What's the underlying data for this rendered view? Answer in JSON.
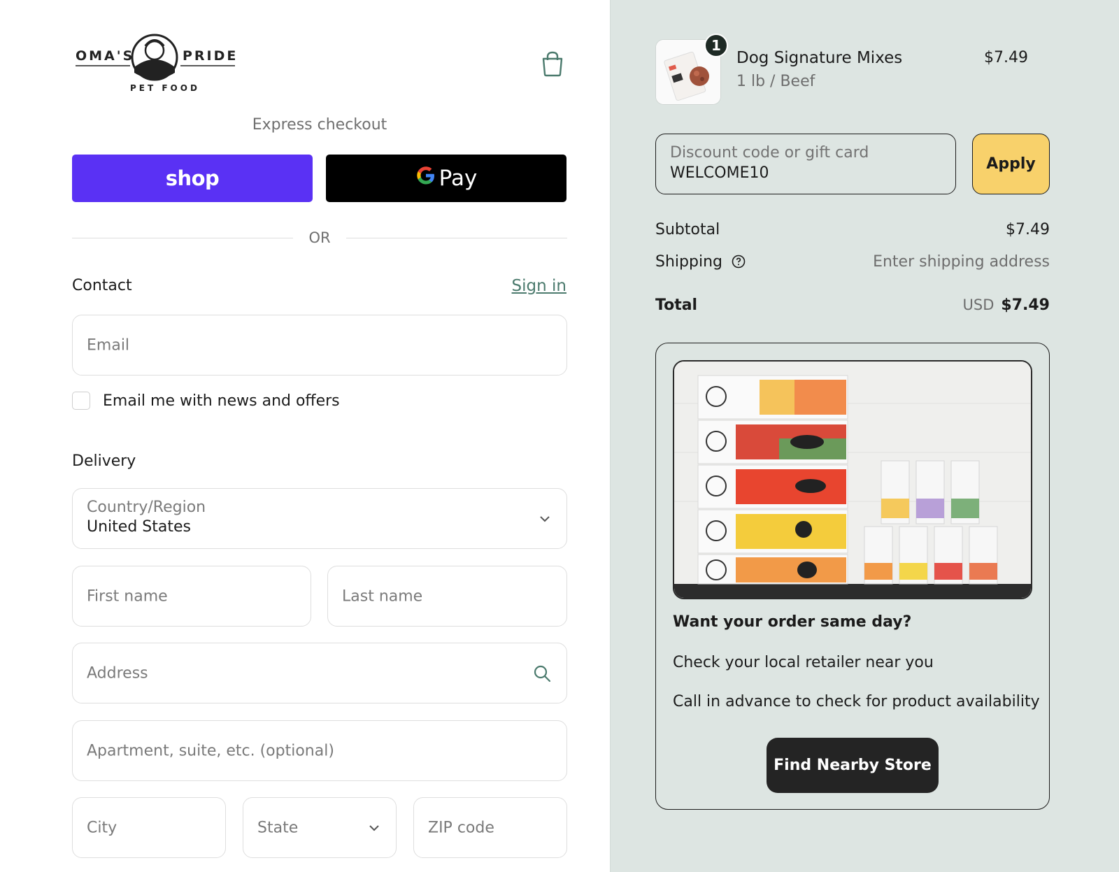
{
  "brand": {
    "logo_text_left": "OMA'S",
    "logo_text_right": "PRIDE",
    "logo_sub": "PET FOOD"
  },
  "express": {
    "label": "Express checkout",
    "shop_label": "shop",
    "gpay_g": "G",
    "gpay_label": "Pay"
  },
  "divider": {
    "or": "OR"
  },
  "contact": {
    "title": "Contact",
    "signin": "Sign in",
    "email_placeholder": "Email",
    "news_label": "Email me with news and offers",
    "news_checked": false
  },
  "delivery": {
    "title": "Delivery",
    "country_label": "Country/Region",
    "country_value": "United States",
    "first_name": "First name",
    "last_name": "Last name",
    "address": "Address",
    "apartment": "Apartment, suite, etc. (optional)",
    "city": "City",
    "state": "State",
    "zip": "ZIP code"
  },
  "order": {
    "item": {
      "qty": "1",
      "name": "Dog Signature Mixes",
      "variant": "1 lb / Beef",
      "price": "$7.49"
    },
    "discount_label": "Discount code or gift card",
    "discount_value": "WELCOME10",
    "apply": "Apply",
    "subtotal_label": "Subtotal",
    "subtotal_value": "$7.49",
    "shipping_label": "Shipping",
    "shipping_value": "Enter shipping address",
    "total_label": "Total",
    "total_currency": "USD",
    "total_value": "$7.49"
  },
  "promo": {
    "title": "Want your order same day?",
    "line1": "Check your local retailer near you",
    "line2": "Call in advance to check for product availability",
    "button": "Find Nearby Store"
  },
  "colors": {
    "shop_purple": "#5a31f4",
    "right_panel_bg": "#dde5e2",
    "apply_yellow": "#f8d16b",
    "link_green": "#4b7a6d"
  }
}
